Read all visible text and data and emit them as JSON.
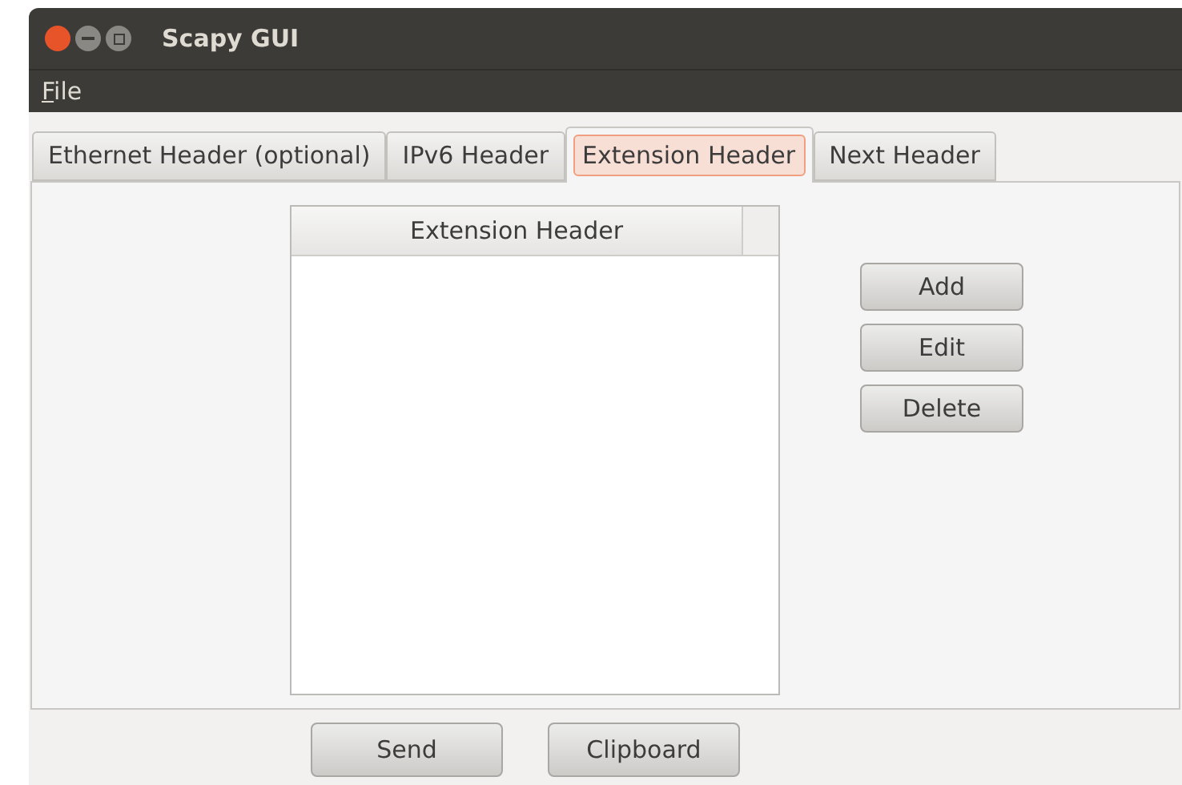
{
  "window": {
    "title": "Scapy GUI"
  },
  "menu": [
    {
      "label": "File",
      "mnemonic": true
    }
  ],
  "tabs": [
    {
      "label": "Ethernet Header (optional)",
      "selected": false
    },
    {
      "label": "IPv6 Header",
      "selected": false
    },
    {
      "label": "Extension Header",
      "selected": true
    },
    {
      "label": "Next Header",
      "selected": false
    }
  ],
  "list": {
    "columns": [
      "Extension Header"
    ]
  },
  "side_buttons": [
    "Add",
    "Edit",
    "Delete"
  ],
  "bottom_buttons": [
    "Send",
    "Clipboard"
  ]
}
